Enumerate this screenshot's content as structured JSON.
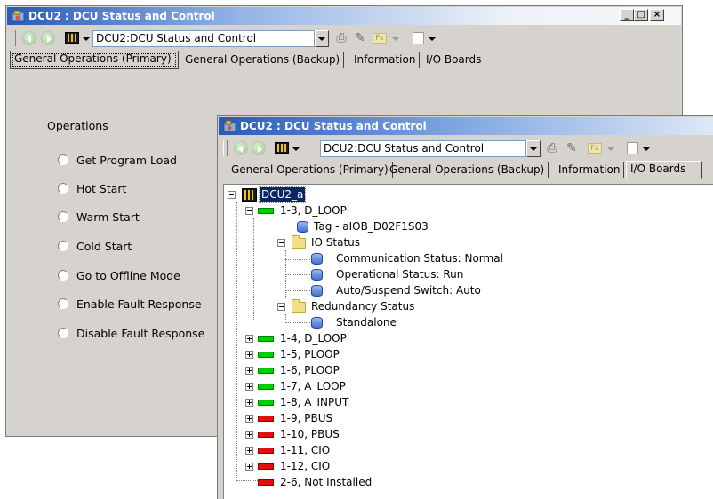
{
  "back_window": {
    "title": "DCU2 : DCU Status and Control",
    "controls": {
      "minimize": "_",
      "maximize": "□",
      "close": "×"
    },
    "address": "DCU2:DCU Status and Control",
    "tabs": [
      "General Operations (Primary)",
      "General Operations (Backup)",
      "Information",
      "I/O Boards"
    ],
    "active_tab": "General Operations (Primary)",
    "group_label": "Operations",
    "options": [
      "Get Program Load",
      "Hot Start",
      "Warm Start",
      "Cold Start",
      "Go to Offline Mode",
      "Enable Fault Response",
      "Disable Fault Response"
    ]
  },
  "front_window": {
    "title": "DCU2 : DCU Status and Control",
    "address": "DCU2:DCU Status and Control",
    "tabs": [
      "General Operations (Primary)",
      "General Operations (Backup)",
      "Information",
      "I/O Boards"
    ],
    "active_tab": "I/O Boards",
    "tree": {
      "root": "DCU2_a",
      "nodes": {
        "n13": "1-3, D_LOOP",
        "tag": "Tag - aIOB_D02F1S03",
        "io_status": "IO Status",
        "comm": "Communication Status: Normal",
        "oper": "Operational Status: Run",
        "auto": "Auto/Suspend Switch: Auto",
        "redund": "Redundancy Status",
        "standalone": "Standalone",
        "n14": "1-4, D_LOOP",
        "n15": "1-5, PLOOP",
        "n16": "1-6, PLOOP",
        "n17": "1-7, A_LOOP",
        "n18": "1-8, A_INPUT",
        "n19": "1-9, PBUS",
        "n110": "1-10, PBUS",
        "n111": "1-11, CIO",
        "n112": "1-12, CIO",
        "n26": "2-6, Not Installed"
      },
      "status_colors": {
        "ok": "#00d000",
        "fault": "#e01010"
      }
    }
  },
  "icons": [
    "app-icon",
    "back-icon",
    "forward-icon",
    "rack-icon",
    "print-icon",
    "pin-icon",
    "fx-icon",
    "page-icon"
  ]
}
